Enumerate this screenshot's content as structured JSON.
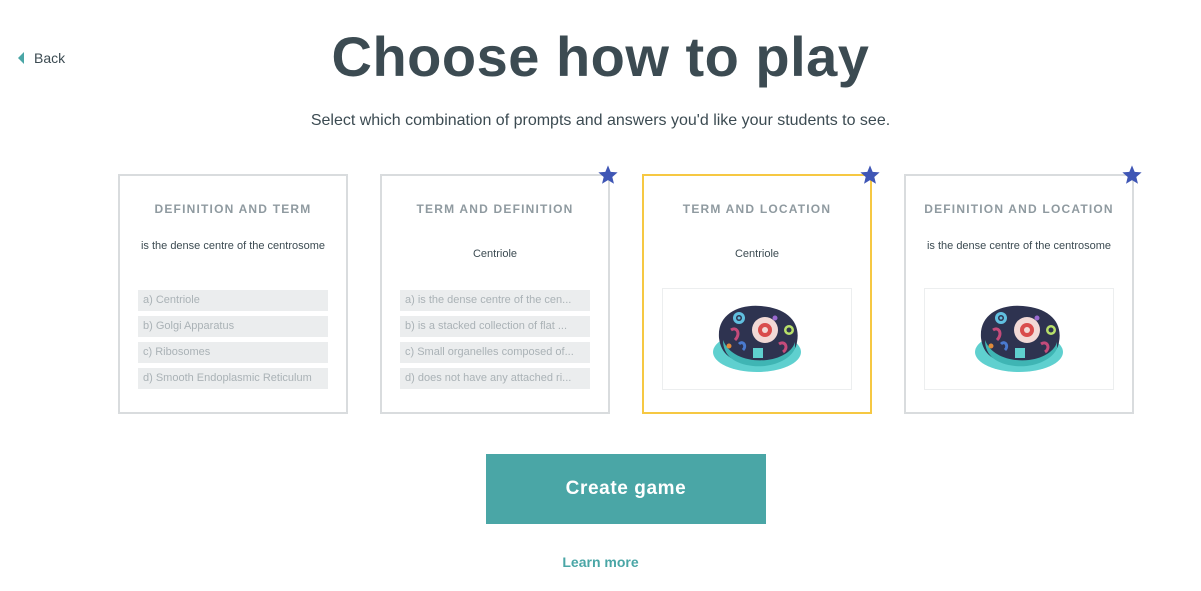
{
  "nav": {
    "back_label": "Back"
  },
  "header": {
    "title": "Choose how to play",
    "subtitle": "Select which combination of prompts and answers you'd like your students to see."
  },
  "cards": [
    {
      "heading": "DEFINITION AND TERM",
      "prompt": "is the dense centre of the centrosome",
      "premium": false,
      "selected": false,
      "answers": [
        "a) Centriole",
        "b) Golgi Apparatus",
        "c) Ribosomes",
        "d) Smooth Endoplasmic Reticulum"
      ]
    },
    {
      "heading": "TERM AND DEFINITION",
      "prompt": "Centriole",
      "premium": true,
      "selected": false,
      "answers": [
        "a) is the dense centre of the cen...",
        "b) is a stacked collection of flat ...",
        "c) Small organelles composed of...",
        "d) does not have any attached ri..."
      ]
    },
    {
      "heading": "TERM AND LOCATION",
      "prompt": "Centriole",
      "premium": true,
      "selected": true,
      "image": "animal-cell-diagram"
    },
    {
      "heading": "DEFINITION AND LOCATION",
      "prompt": "is the dense centre of the centrosome",
      "premium": true,
      "selected": false,
      "image": "animal-cell-diagram"
    }
  ],
  "actions": {
    "create_label": "Create game",
    "learn_more_label": "Learn more"
  },
  "colors": {
    "accent": "#4aa6a6",
    "selected_border": "#f6c843",
    "premium_star": "#3f56b5",
    "text": "#3c4b52"
  }
}
